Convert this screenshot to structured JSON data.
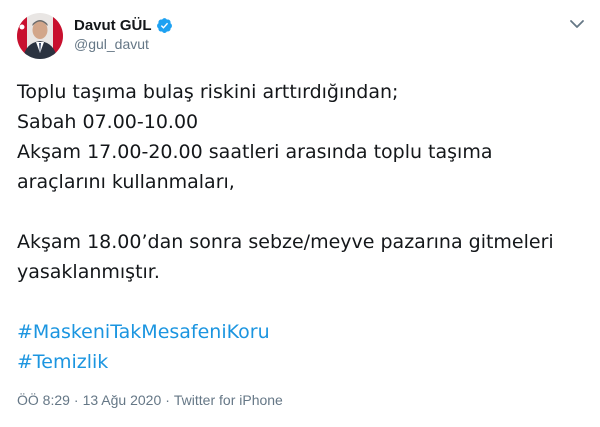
{
  "author": {
    "display_name": "Davut GÜL",
    "handle": "@gul_davut",
    "verified": true
  },
  "tweet": {
    "lines": [
      "Toplu taşıma bulaş riskini arttırdığından;",
      "Sabah 07.00-10.00",
      "Akşam 17.00-20.00 saatleri arasında toplu taşıma",
      "araçlarını kullanmaları,",
      "",
      "Akşam 18.00’dan sonra sebze/meyve pazarına gitmeleri",
      "yasaklanmıştır."
    ],
    "hashtags": [
      "#MaskeniTakMesafeniKoru",
      "#Temizlik"
    ]
  },
  "meta": {
    "time": "ÖÖ 8:29",
    "separator_1": "·",
    "date": "13 Ağu 2020",
    "separator_2": "·",
    "source": "Twitter for iPhone"
  },
  "colors": {
    "link": "#1b95e0",
    "verified": "#1da1f2",
    "muted": "#657786",
    "text": "#14171a"
  },
  "icons": {
    "verified": "verified-badge-icon",
    "menu": "chevron-down-icon"
  }
}
